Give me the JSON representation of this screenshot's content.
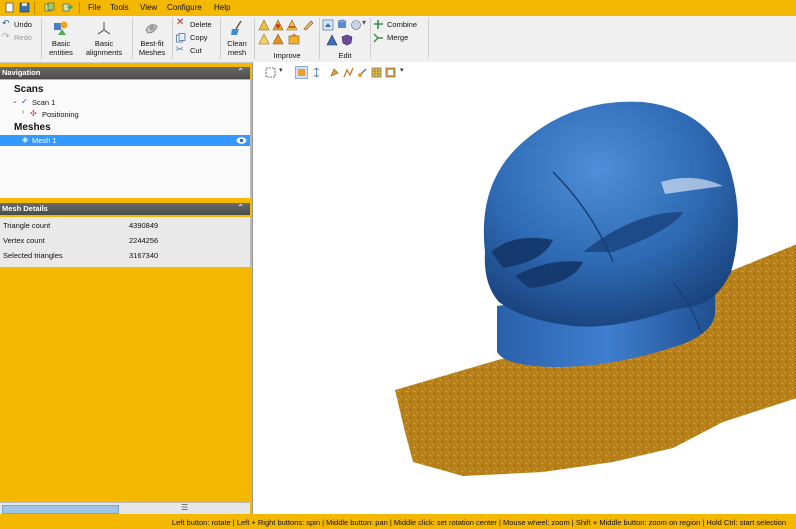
{
  "menu": [
    "File",
    "Tools",
    "View",
    "Configure",
    "Help"
  ],
  "ribbon": {
    "undo": "Undo",
    "redo": "Redo",
    "basic_entities": [
      "Basic",
      "entities"
    ],
    "basic_alignments": [
      "Basic",
      "alignments"
    ],
    "best_fit_meshes": [
      "Best-fit",
      "Meshes"
    ],
    "delete": "Delete",
    "copy": "Copy",
    "cut": "Cut",
    "clean_mesh": [
      "Clean",
      "mesh"
    ],
    "improve": "Improve",
    "edit": "Edit",
    "combine": "Combine",
    "merge": "Merge"
  },
  "navigation": {
    "title": "Navigation",
    "scans_label": "Scans",
    "scan1_label": "Scan 1",
    "positioning_label": "Positioning",
    "meshes_label": "Meshes",
    "mesh1_label": "Mesh 1"
  },
  "mesh_details": {
    "title": "Mesh Details",
    "rows": [
      {
        "label": "Triangle count",
        "value": "4390849"
      },
      {
        "label": "Vertex count",
        "value": "2244256"
      },
      {
        "label": "Selected triangles",
        "value": "3167340"
      }
    ]
  },
  "status_bar": "Left button: rotate  |  Left + Right buttons: spin  |  Middle button: pan  |  Middle click: set rotation center  |  Mouse wheel: zoom  |  Shift + Middle button: zoom on region  |  Hold Ctrl: start selection",
  "colors": {
    "accent": "#f5b800",
    "selection": "#3399ff",
    "mesh": "#2f6bb5",
    "scan": "#b57a0e"
  }
}
